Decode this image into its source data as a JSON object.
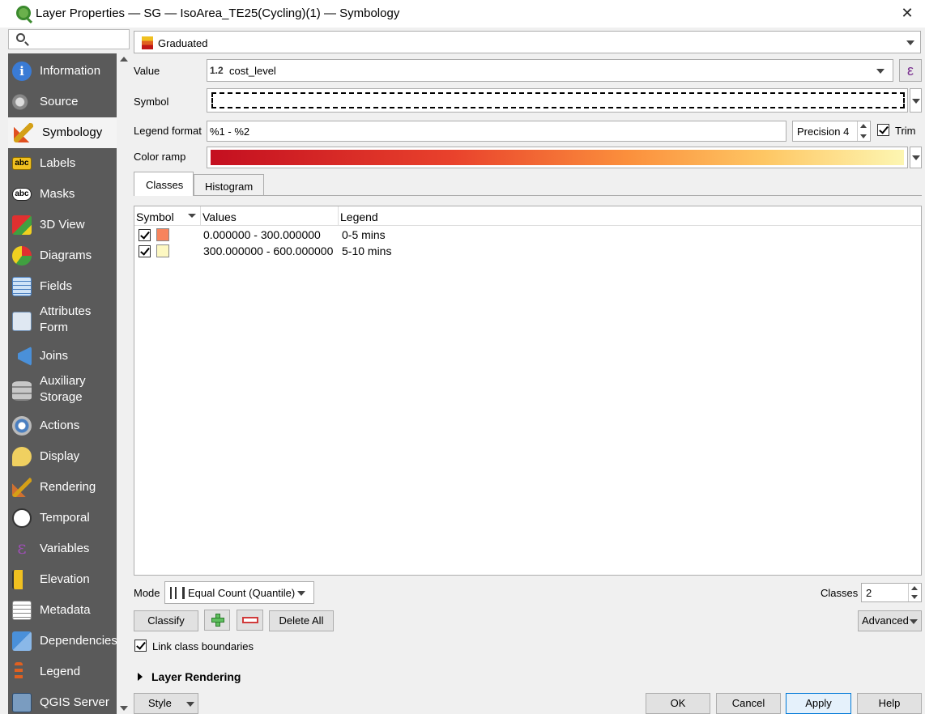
{
  "window": {
    "title": "Layer Properties — SG — IsoArea_TE25(Cycling)(1) — Symbology",
    "close_glyph": "✕"
  },
  "sidebar": {
    "search_placeholder": "",
    "items": [
      {
        "label": "Information",
        "icon": "information-icon"
      },
      {
        "label": "Source",
        "icon": "source-icon"
      },
      {
        "label": "Symbology",
        "icon": "symbology-icon"
      },
      {
        "label": "Labels",
        "icon": "labels-icon"
      },
      {
        "label": "Masks",
        "icon": "masks-icon"
      },
      {
        "label": "3D View",
        "icon": "3d-view-icon"
      },
      {
        "label": "Diagrams",
        "icon": "diagrams-icon"
      },
      {
        "label": "Fields",
        "icon": "fields-icon"
      },
      {
        "label": "Attributes\nForm",
        "icon": "attributes-form-icon"
      },
      {
        "label": "Joins",
        "icon": "joins-icon"
      },
      {
        "label": "Auxiliary\nStorage",
        "icon": "auxiliary-storage-icon"
      },
      {
        "label": "Actions",
        "icon": "actions-icon"
      },
      {
        "label": "Display",
        "icon": "display-icon"
      },
      {
        "label": "Rendering",
        "icon": "rendering-icon"
      },
      {
        "label": "Temporal",
        "icon": "temporal-icon"
      },
      {
        "label": "Variables",
        "icon": "variables-icon"
      },
      {
        "label": "Elevation",
        "icon": "elevation-icon"
      },
      {
        "label": "Metadata",
        "icon": "metadata-icon"
      },
      {
        "label": "Dependencies",
        "icon": "dependencies-icon"
      },
      {
        "label": "Legend",
        "icon": "legend-icon"
      },
      {
        "label": "QGIS Server",
        "icon": "qgis-server-icon"
      }
    ],
    "icon_labels": {
      "labels": "abc",
      "masks": "abc"
    }
  },
  "symbology": {
    "renderer": "Graduated",
    "value_label": "Value",
    "value_type": "1.2",
    "value_field": "cost_level",
    "expression_glyph": "ε",
    "symbol_label": "Symbol",
    "legend_format_label": "Legend format",
    "legend_format": "%1 - %2",
    "precision": "Precision 4",
    "trim_label": "Trim",
    "color_ramp_label": "Color ramp",
    "tabs": [
      "Classes",
      "Histogram"
    ],
    "table": {
      "headers": [
        "Symbol",
        "Values",
        "Legend"
      ],
      "rows": [
        {
          "values": "0.000000 - 300.000000",
          "legend": "0-5 mins",
          "color": "#f7845d"
        },
        {
          "values": "300.000000 - 600.000000",
          "legend": "5-10 mins",
          "color": "#fdf8c2"
        }
      ]
    },
    "mode_label": "Mode",
    "mode": "Equal Count (Quantile)",
    "classes_label": "Classes",
    "classes": "2",
    "classify_button": "Classify",
    "delete_all_button": "Delete All",
    "advanced_button": "Advanced",
    "link_class_boundaries": "Link class boundaries",
    "layer_rendering": "Layer Rendering"
  },
  "footer": {
    "style": "Style",
    "ok": "OK",
    "cancel": "Cancel",
    "apply": "Apply",
    "help": "Help"
  }
}
